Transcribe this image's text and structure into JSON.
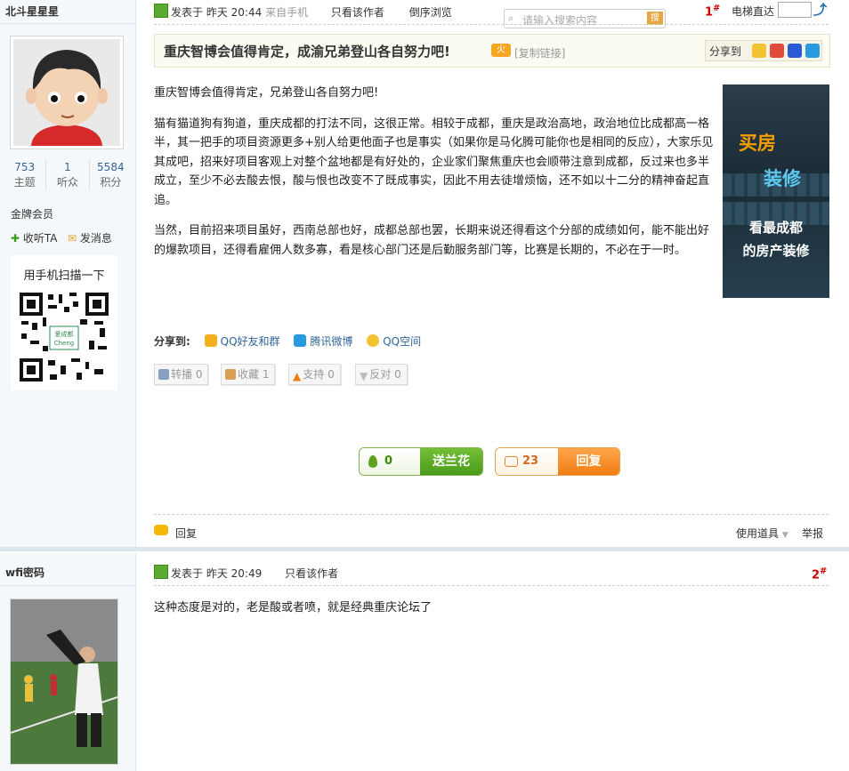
{
  "post1": {
    "author": {
      "name": "北斗星星星",
      "stats": [
        {
          "value": "753",
          "label": "主题"
        },
        {
          "value": "1",
          "label": "听众"
        },
        {
          "value": "5584",
          "label": "积分"
        }
      ],
      "rank": "金牌会员",
      "follow_label": "收听TA",
      "message_label": "发消息",
      "qr_title": "用手机扫描一下",
      "qr_caption": "爱成都\nCheng"
    },
    "meta": {
      "posted_label": "发表于",
      "time": "昨天 20:44",
      "source": "来自手机",
      "only_author": "只看该作者",
      "reverse": "倒序浏览"
    },
    "search_placeholder": "请输入搜索内容",
    "search_btn": "搜",
    "floor": "1",
    "floor_mark": "#",
    "goto_label": "电梯直达",
    "title": "重庆智博会值得肯定，成渝兄弟登山各自努力吧!",
    "copy_link": "[复制链接]",
    "share_to": "分享到",
    "paragraphs": [
      "重庆智博会值得肯定，兄弟登山各自努力吧!",
      "猫有猫道狗有狗道，重庆成都的打法不同，这很正常。相较于成都，重庆是政治高地，政治地位比成都高一格半，其一把手的项目资源更多+别人给更他面子也是事实（如果你是马化腾可能你也是相同的反应），大家乐见其成吧，招来好项目客观上对整个盆地都是有好处的，企业家们聚焦重庆也会顺带注意到成都，反过来也多半成立，至少不必去酸去恨，酸与恨也改变不了既成事实，因此不用去徒增烦恼，还不如以十二分的精神奋起直追。",
      "当然，目前招来项目虽好，西南总部也好，成都总部也罢，长期来说还得看这个分部的成绩如何，能不能出好的爆款项目，还得看雇佣人数多寡，看是核心部门还是后勤服务部门等，比赛是长期的，不必在于一时。"
    ],
    "ad": {
      "line1": "买房",
      "line2": "装修",
      "line3": "看最成都",
      "line4": "的房产装修"
    },
    "share_row": {
      "label": "分享到:",
      "items": [
        "QQ好友和群",
        "腾讯微博",
        "QQ空间"
      ]
    },
    "actions": [
      {
        "label": "转播",
        "count": "0"
      },
      {
        "label": "收藏",
        "count": "1"
      },
      {
        "label": "支持",
        "count": "0"
      },
      {
        "label": "反对",
        "count": "0"
      }
    ],
    "flower": {
      "count": "0",
      "label": "送兰花"
    },
    "reply_btn": {
      "count": "23",
      "label": "回复"
    },
    "footer": {
      "reply": "回复",
      "tools": "使用道具",
      "report": "举报"
    }
  },
  "post2": {
    "author": {
      "name": "wfi密码"
    },
    "meta": {
      "posted_label": "发表于",
      "time": "昨天 20:49",
      "only_author": "只看该作者"
    },
    "floor": "2",
    "floor_mark": "#",
    "body": "这种态度是对的，老是酸或者喷，就是经典重庆论坛了"
  },
  "colors": {
    "link": "#336699",
    "floor": "#cc0000",
    "flower_green": "#4a9a1a",
    "reply_orange": "#f07d12",
    "ad_orange": "#f5a000",
    "ad_blue": "#5cc8ef"
  }
}
